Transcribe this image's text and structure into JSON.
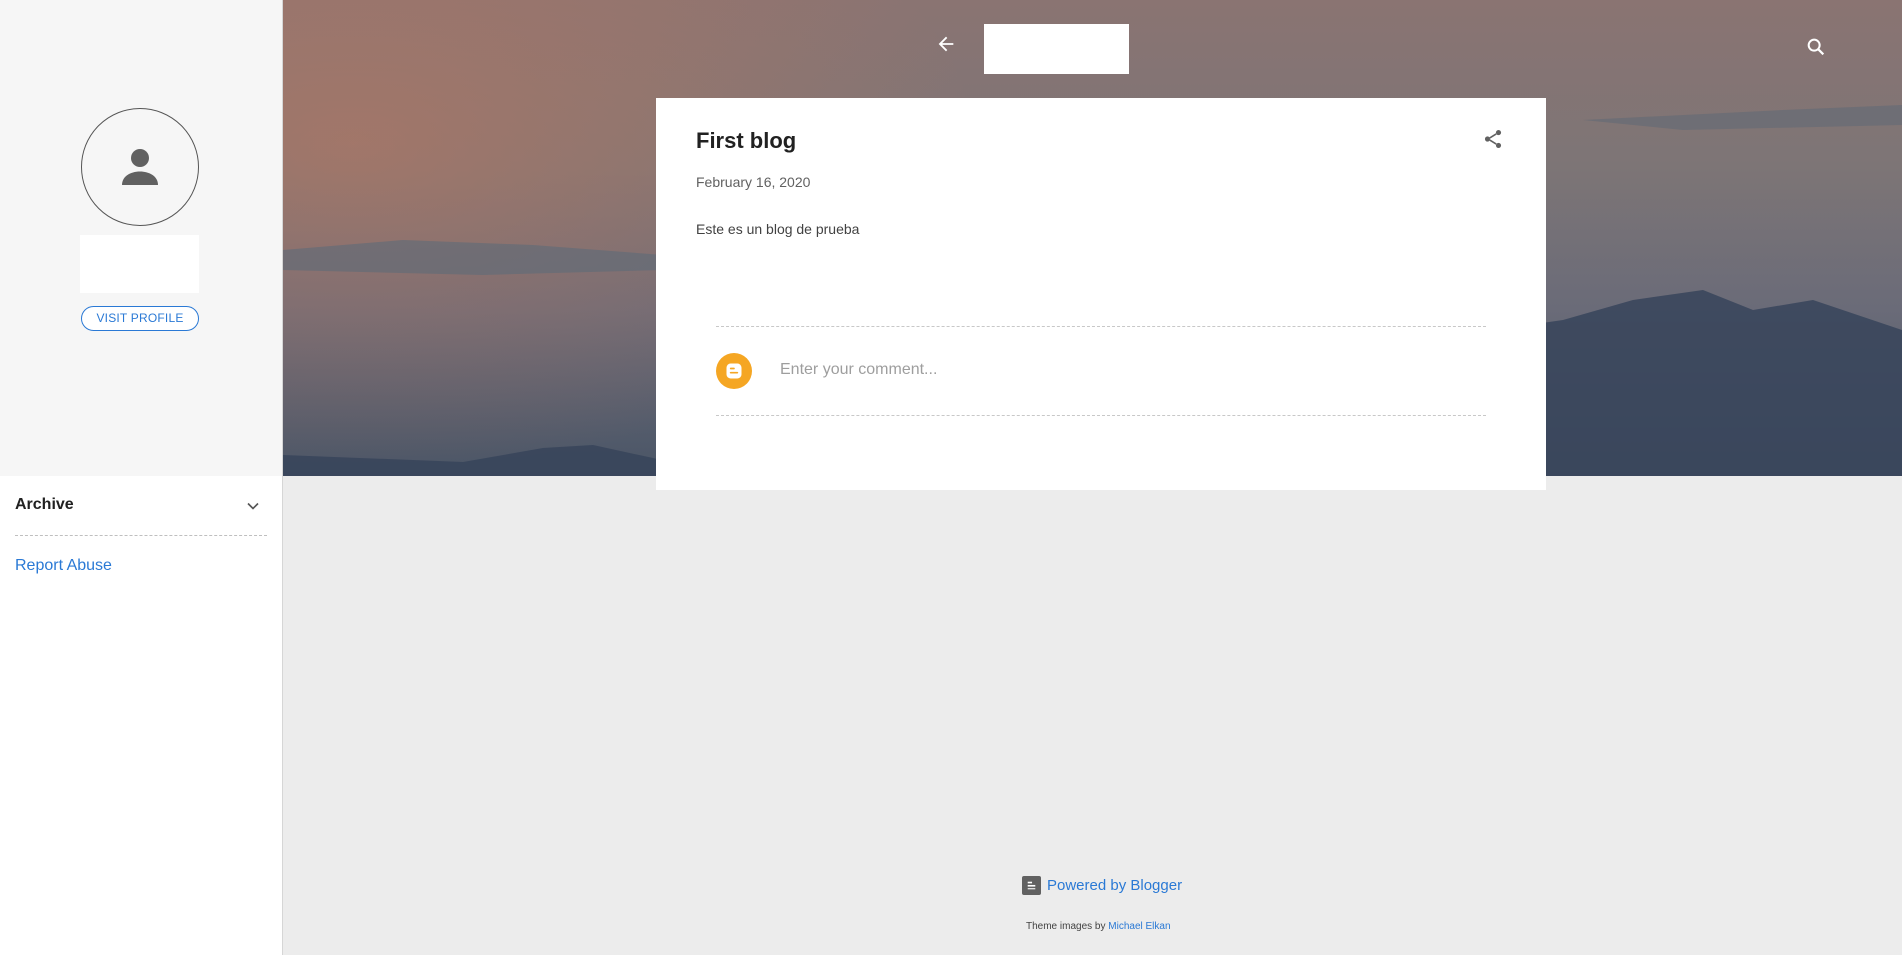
{
  "sidebar": {
    "visit_profile_label": "VISIT PROFILE",
    "archive_title": "Archive",
    "report_abuse_label": "Report Abuse"
  },
  "post": {
    "title": "First blog",
    "date": "February 16, 2020",
    "body": "Este es un blog de prueba",
    "comment_placeholder": "Enter your comment..."
  },
  "footer": {
    "powered_by": "Powered by Blogger",
    "theme_images_prefix": "Theme images by",
    "theme_author": "Michael Elkan"
  },
  "icons": {
    "back": "arrow-left-icon",
    "search": "search-icon",
    "share": "share-icon",
    "chevron": "chevron-down-icon",
    "avatar": "person-icon",
    "blogger": "blogger-logo-icon"
  },
  "colors": {
    "link": "#2a79d5",
    "text": "#212121",
    "blogger_orange": "#f5a623"
  }
}
